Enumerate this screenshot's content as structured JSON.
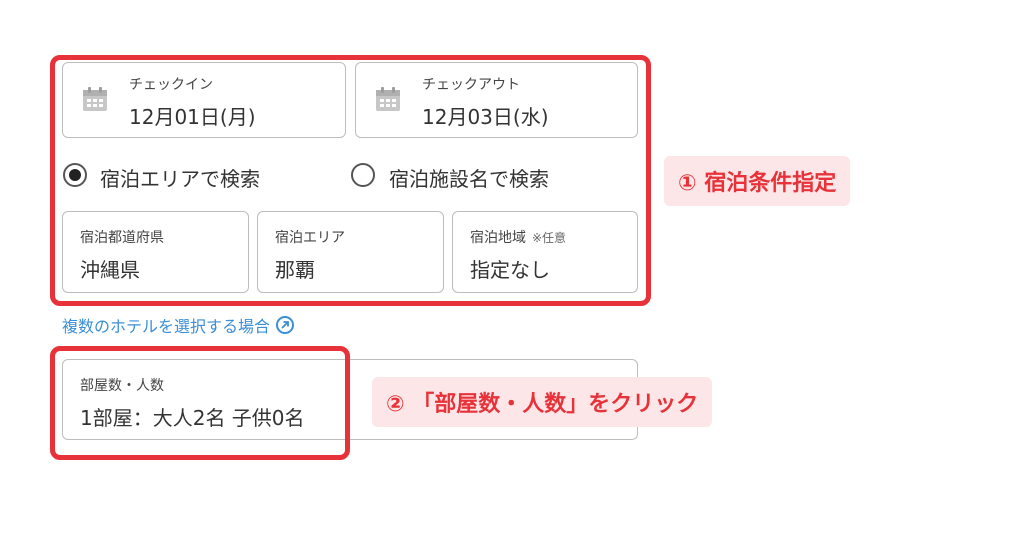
{
  "checkin": {
    "label": "チェックイン",
    "date": "12月01日(月)"
  },
  "checkout": {
    "label": "チェックアウト",
    "date": "12月03日(水)"
  },
  "search_mode": {
    "options": [
      {
        "label": "宿泊エリアで検索",
        "selected": true
      },
      {
        "label": "宿泊施設名で検索",
        "selected": false
      }
    ]
  },
  "prefecture": {
    "label": "宿泊都道府県",
    "value": "沖縄県"
  },
  "area": {
    "label": "宿泊エリア",
    "value": "那覇"
  },
  "region": {
    "label": "宿泊地域",
    "optional": "※任意",
    "value": "指定なし"
  },
  "multi_hotel_link": "複数のホテルを選択する場合",
  "rooms": {
    "label": "部屋数・人数",
    "value": "1部屋：大人2名 子供0名"
  },
  "annotations": {
    "step1": "① 宿泊条件指定",
    "step2": "② 「部屋数・人数」をクリック"
  },
  "colors": {
    "accent_red": "#e8323a",
    "callout_bg": "#fde6e7",
    "link_blue": "#3a8fd6"
  }
}
